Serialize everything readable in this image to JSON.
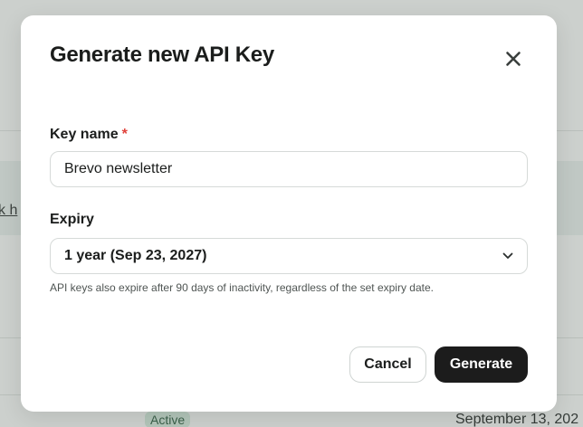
{
  "background": {
    "link_text": "k h",
    "status_badge": "Active",
    "date_text": "September 13, 202"
  },
  "modal": {
    "title": "Generate new API Key",
    "close_icon": "close-icon",
    "key_name": {
      "label": "Key name",
      "required_mark": "*",
      "value": "Brevo newsletter"
    },
    "expiry": {
      "label": "Expiry",
      "selected": "1 year (Sep 23, 2027)",
      "helper": "API keys also expire after 90 days of inactivity, regardless of the set expiry date."
    },
    "actions": {
      "cancel_label": "Cancel",
      "generate_label": "Generate"
    }
  },
  "colors": {
    "primary_button": "#1c1c1c",
    "required": "#e0413a",
    "overlay": "#5f6e64"
  }
}
